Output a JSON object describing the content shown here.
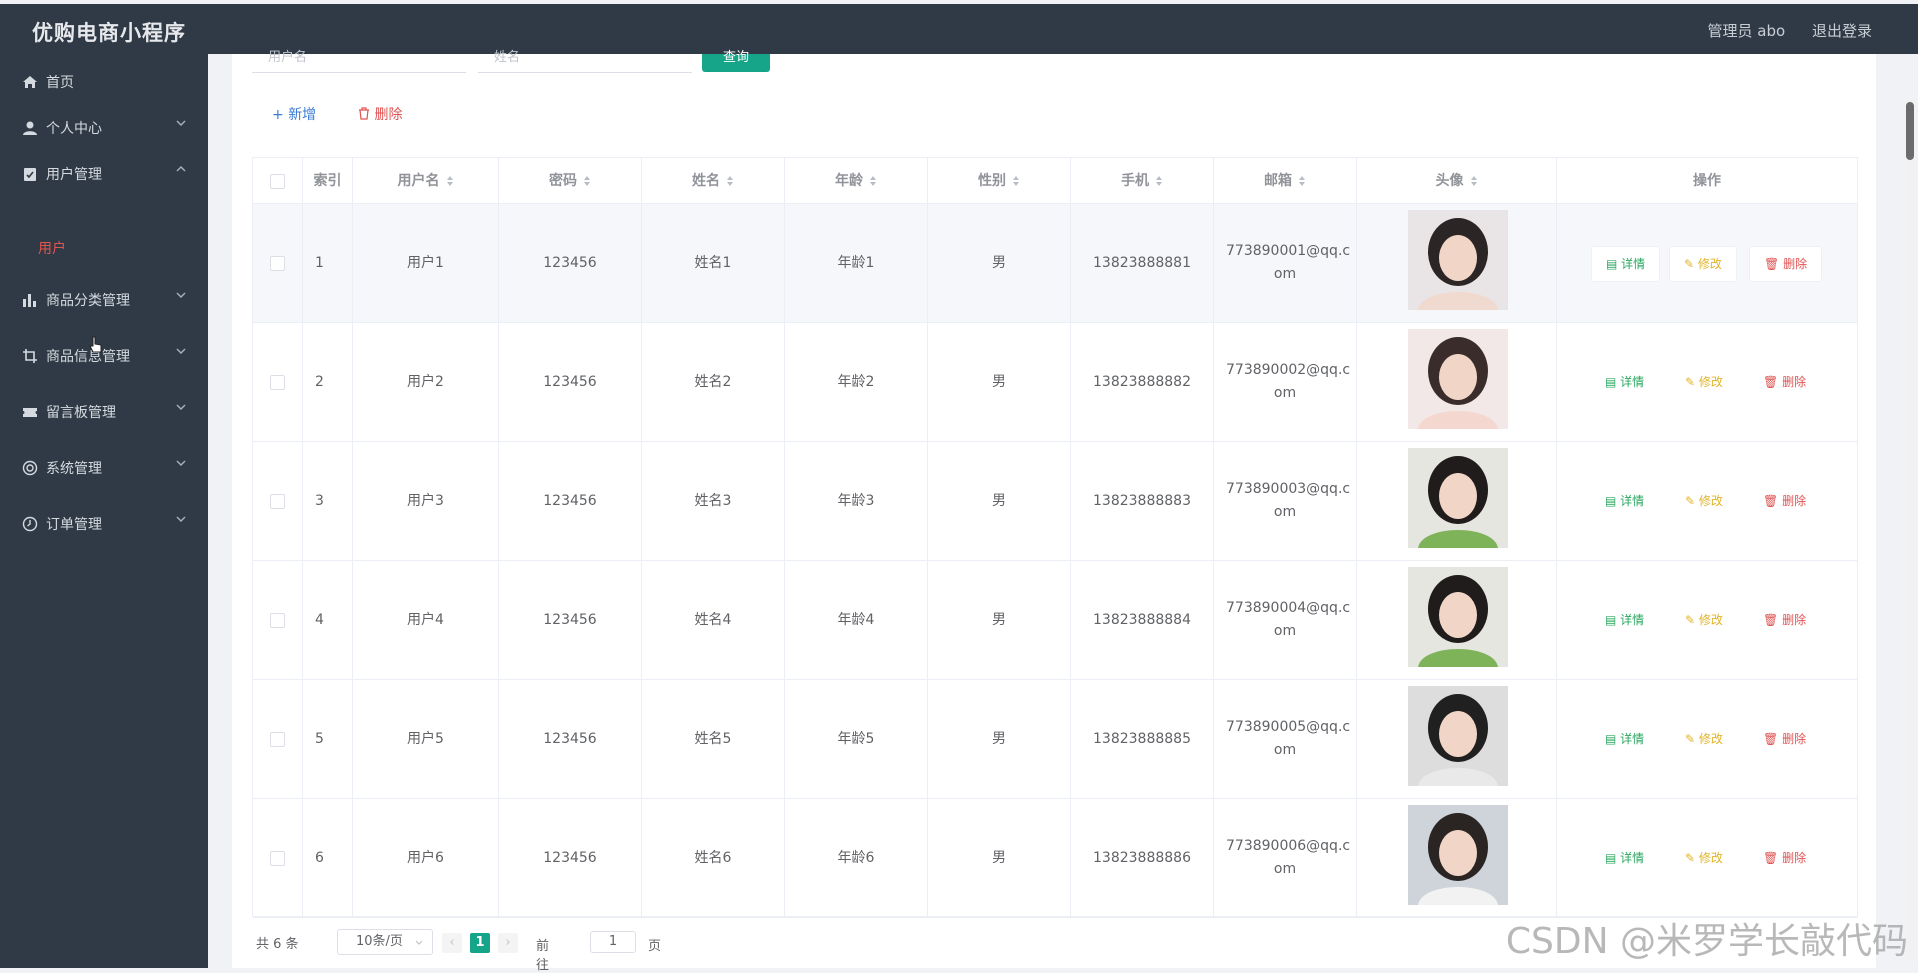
{
  "header": {
    "title": "优购电商小程序",
    "admin_label": "管理员 abo",
    "logout_label": "退出登录"
  },
  "sidebar": {
    "items": [
      {
        "label": "首页",
        "icon": "home-icon",
        "arrow": ""
      },
      {
        "label": "个人中心",
        "icon": "person-icon",
        "arrow": "down"
      },
      {
        "label": "用户管理",
        "icon": "clipboard-icon",
        "arrow": "up"
      },
      {
        "label": "商品分类管理",
        "icon": "bar-chart-icon",
        "arrow": "down"
      },
      {
        "label": "商品信息管理",
        "icon": "crop-icon",
        "arrow": "down"
      },
      {
        "label": "留言板管理",
        "icon": "ticket-icon",
        "arrow": "down"
      },
      {
        "label": "系统管理",
        "icon": "target-icon",
        "arrow": "down"
      },
      {
        "label": "订单管理",
        "icon": "clock-icon",
        "arrow": "down"
      }
    ],
    "submenu": {
      "label": "用户",
      "color": "#e0564d"
    }
  },
  "search": {
    "username_placeholder": "用户名",
    "name_placeholder": "姓名",
    "button_label": "查询"
  },
  "toolbar": {
    "add_label": "新增",
    "delete_label": "删除"
  },
  "table": {
    "headers": [
      "索引",
      "用户名",
      "密码",
      "姓名",
      "年龄",
      "性别",
      "手机",
      "邮箱",
      "头像",
      "操作"
    ],
    "rows": [
      {
        "index": "1",
        "username": "用户1",
        "password": "123456",
        "name": "姓名1",
        "age": "年龄1",
        "gender": "男",
        "phone": "13823888881",
        "email": "773890001@qq.com",
        "email_l1": "773890001@qq.c",
        "email_l2": "om"
      },
      {
        "index": "2",
        "username": "用户2",
        "password": "123456",
        "name": "姓名2",
        "age": "年龄2",
        "gender": "男",
        "phone": "13823888882",
        "email": "773890002@qq.com",
        "email_l1": "773890002@qq.c",
        "email_l2": "om"
      },
      {
        "index": "3",
        "username": "用户3",
        "password": "123456",
        "name": "姓名3",
        "age": "年龄3",
        "gender": "男",
        "phone": "13823888883",
        "email": "773890003@qq.com",
        "email_l1": "773890003@qq.c",
        "email_l2": "om"
      },
      {
        "index": "4",
        "username": "用户4",
        "password": "123456",
        "name": "姓名4",
        "age": "年龄4",
        "gender": "男",
        "phone": "13823888884",
        "email": "773890004@qq.com",
        "email_l1": "773890004@qq.c",
        "email_l2": "om"
      },
      {
        "index": "5",
        "username": "用户5",
        "password": "123456",
        "name": "姓名5",
        "age": "年龄5",
        "gender": "男",
        "phone": "13823888885",
        "email": "773890005@qq.com",
        "email_l1": "773890005@qq.c",
        "email_l2": "om"
      },
      {
        "index": "6",
        "username": "用户6",
        "password": "123456",
        "name": "姓名6",
        "age": "年龄6",
        "gender": "男",
        "phone": "13823888886",
        "email": "773890006@qq.com",
        "email_l1": "773890006@qq.c",
        "email_l2": "om"
      }
    ],
    "ops": {
      "detail": "详情",
      "edit": "修改",
      "delete": "删除"
    }
  },
  "pagination": {
    "total_label": "共 6 条",
    "page_size": "10条/页",
    "current_page": "1",
    "goto_label": "前往",
    "goto_value": "1",
    "page_label": "页"
  },
  "watermark": "CSDN @米罗学长敲代码",
  "colors": {
    "sidebar_bg": "#2f3a46",
    "accent": "#17a589",
    "detail": "#2aa760",
    "edit": "#e2b429",
    "delete": "#e05252"
  }
}
